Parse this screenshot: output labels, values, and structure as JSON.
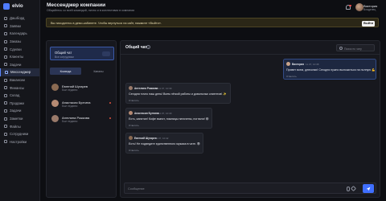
{
  "app": {
    "logo_text": "elvio"
  },
  "sidebar": {
    "items": [
      {
        "label": "Дашборд",
        "icon": "dashboard-icon",
        "active": false
      },
      {
        "label": "Заявки",
        "icon": "requests-icon",
        "active": false
      },
      {
        "label": "Календарь",
        "icon": "calendar-icon",
        "active": false
      },
      {
        "label": "Заказы",
        "icon": "orders-icon",
        "active": false
      },
      {
        "label": "Сделки",
        "icon": "deals-icon",
        "active": false
      },
      {
        "label": "Клиенты",
        "icon": "clients-icon",
        "active": false
      },
      {
        "label": "Задачи",
        "icon": "tasks-icon",
        "active": false
      },
      {
        "label": "Мессенджер",
        "icon": "messenger-icon",
        "active": true
      },
      {
        "label": "Вакансии",
        "icon": "vacancies-icon",
        "active": false
      },
      {
        "label": "Финансы",
        "icon": "finance-icon",
        "active": false
      },
      {
        "label": "Склад",
        "icon": "warehouse-icon",
        "active": false
      },
      {
        "label": "Продажи",
        "icon": "sales-icon",
        "active": false
      },
      {
        "label": "Задачи",
        "icon": "tasks-icon",
        "active": false
      },
      {
        "label": "Заметки",
        "icon": "notes-icon",
        "active": false
      },
      {
        "label": "Файлы",
        "icon": "files-icon",
        "active": false
      },
      {
        "label": "Сотрудники",
        "icon": "staff-icon",
        "active": false
      },
      {
        "label": "Настройки",
        "icon": "settings-icon",
        "active": false
      }
    ]
  },
  "header": {
    "title": "Мессенджер компании",
    "subtitle": "Общайтесь со всей командой, лично и в коллективах в компании",
    "user_name": "Виктория",
    "user_role": "Владелец"
  },
  "banner": {
    "text": "Вы находитесь в демо-кабинете. Чтобы вернуться на сайт, нажмите «Выйти».",
    "button": "Выйти"
  },
  "left_panel": {
    "chat_card": {
      "title": "Общий чат",
      "subtitle": "Все сотрудники"
    },
    "tabs": [
      {
        "label": "Команда",
        "active": true
      },
      {
        "label": "Каналы",
        "active": false
      }
    ],
    "contacts": [
      {
        "name": "Евгений Шугарев",
        "role": "Был недавно",
        "avatar_color": "#8a6a52",
        "unread": false
      },
      {
        "name": "Анастасия Булгина",
        "role": "Был недавно",
        "avatar_color": "#b58a73",
        "unread": true
      },
      {
        "name": "Ангелина Рожкова",
        "role": "Был недавно",
        "avatar_color": "#9a7a6a",
        "unread": true
      }
    ]
  },
  "chat": {
    "title": "Общий чат",
    "info_glyph": "i",
    "search_placeholder": "Поиск по чату",
    "composer_placeholder": "Сообщение",
    "messages": [
      {
        "author": "Виктория",
        "time": "11.07, 10:38",
        "text": "Привет всем, девчонки! Сегодня нужно выложиться на полную 💪",
        "reply": "Ответить",
        "own": true,
        "avatar_color": "#c9a48b"
      },
      {
        "author": "Ангелина Рожкова",
        "time": "11.07, 10:39",
        "text": "Сегодня точно наш день! Всем лёгкой работы и довольных клиентов! ✨",
        "reply": "Ответить",
        "own": false,
        "avatar_color": "#9a7a6a"
      },
      {
        "author": "Анастасия Булгина",
        "time": "11.07, 10:40",
        "text": "Есть, капитан! Кофе выпит, ножницы наточены, погнали! 😄",
        "reply": "Ответить",
        "own": false,
        "avatar_color": "#b58a73"
      },
      {
        "author": "Евгений Шугарев",
        "time": "11.07, 10:42",
        "text": "Есть! Не подведите единственного мужика в чате. 😎",
        "reply": "Ответить",
        "own": false,
        "avatar_color": "#8a6a52"
      }
    ]
  },
  "colors": {
    "accent": "#3f6fff",
    "banner_bg": "#2b2717",
    "unread_dot": "#e0523f"
  }
}
